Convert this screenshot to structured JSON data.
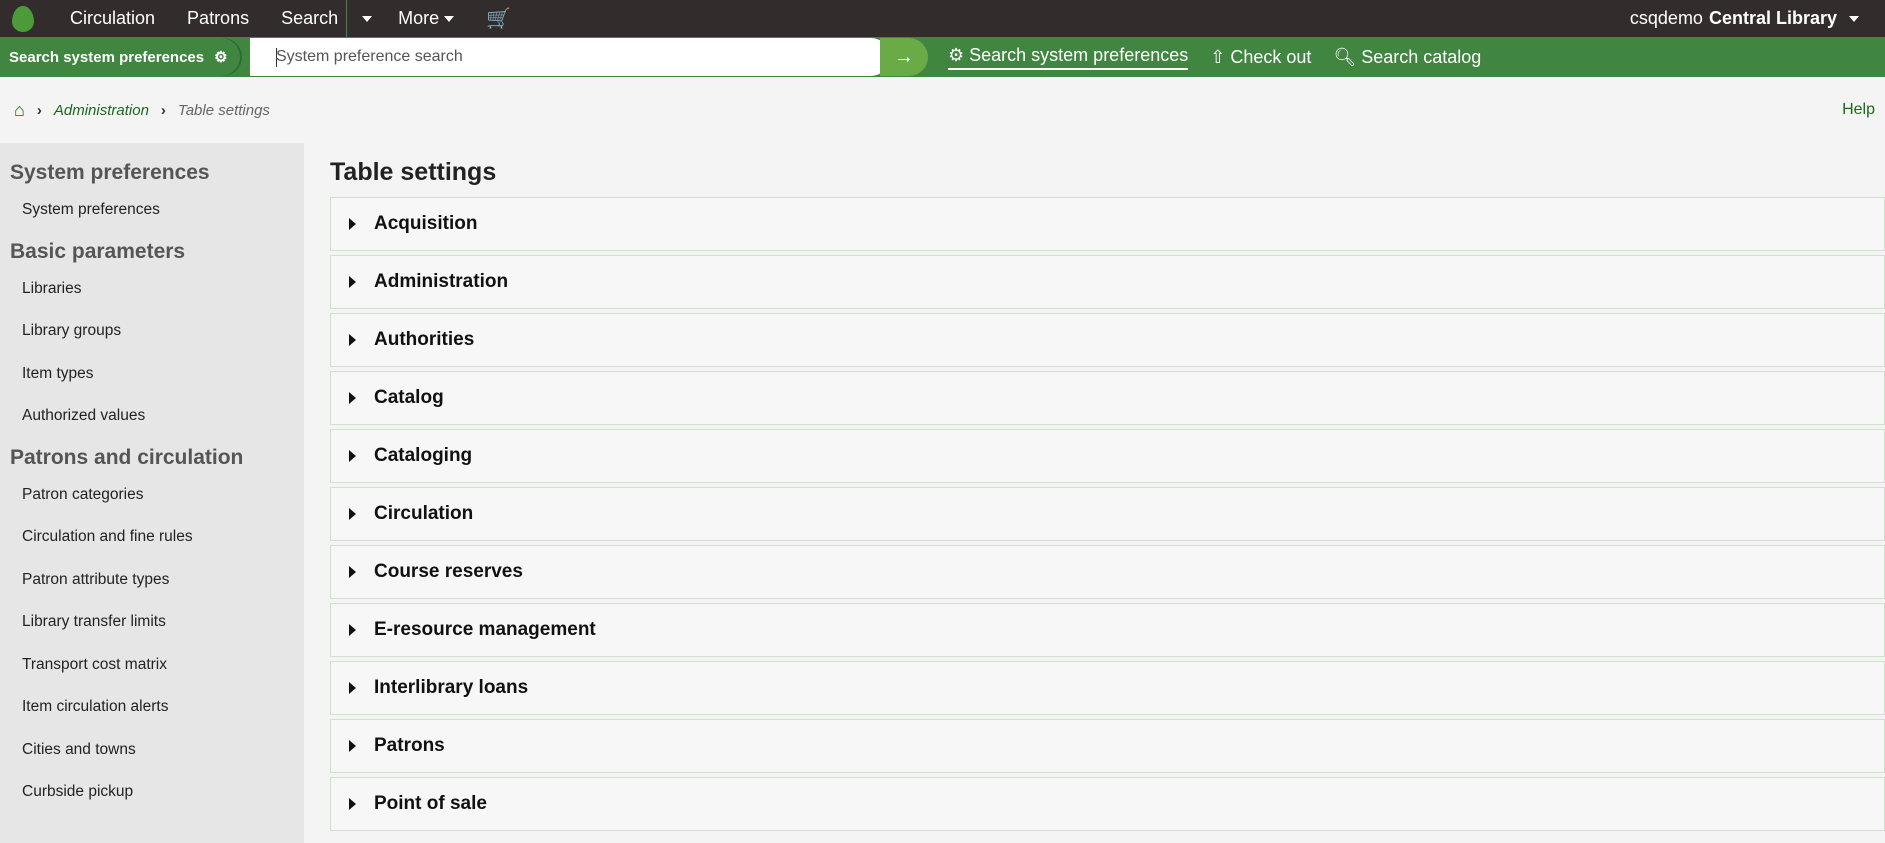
{
  "topbar": {
    "nav": [
      "Circulation",
      "Patrons",
      "Search",
      "More"
    ],
    "user": "csqdemo",
    "library": "Central Library"
  },
  "searchbar": {
    "label": "Search system preferences",
    "placeholder": "System preference search",
    "links": [
      "Search system preferences",
      "Check out",
      "Search catalog"
    ]
  },
  "breadcrumb": {
    "admin": "Administration",
    "current": "Table settings",
    "help": "Help"
  },
  "sidebar": [
    {
      "heading": "System preferences",
      "items": [
        "System preferences"
      ]
    },
    {
      "heading": "Basic parameters",
      "items": [
        "Libraries",
        "Library groups",
        "Item types",
        "Authorized values"
      ]
    },
    {
      "heading": "Patrons and circulation",
      "items": [
        "Patron categories",
        "Circulation and fine rules",
        "Patron attribute types",
        "Library transfer limits",
        "Transport cost matrix",
        "Item circulation alerts",
        "Cities and towns",
        "Curbside pickup"
      ]
    }
  ],
  "main": {
    "title": "Table settings",
    "panels": [
      "Acquisition",
      "Administration",
      "Authorities",
      "Catalog",
      "Cataloging",
      "Circulation",
      "Course reserves",
      "E-resource management",
      "Interlibrary loans",
      "Patrons",
      "Point of sale"
    ]
  }
}
